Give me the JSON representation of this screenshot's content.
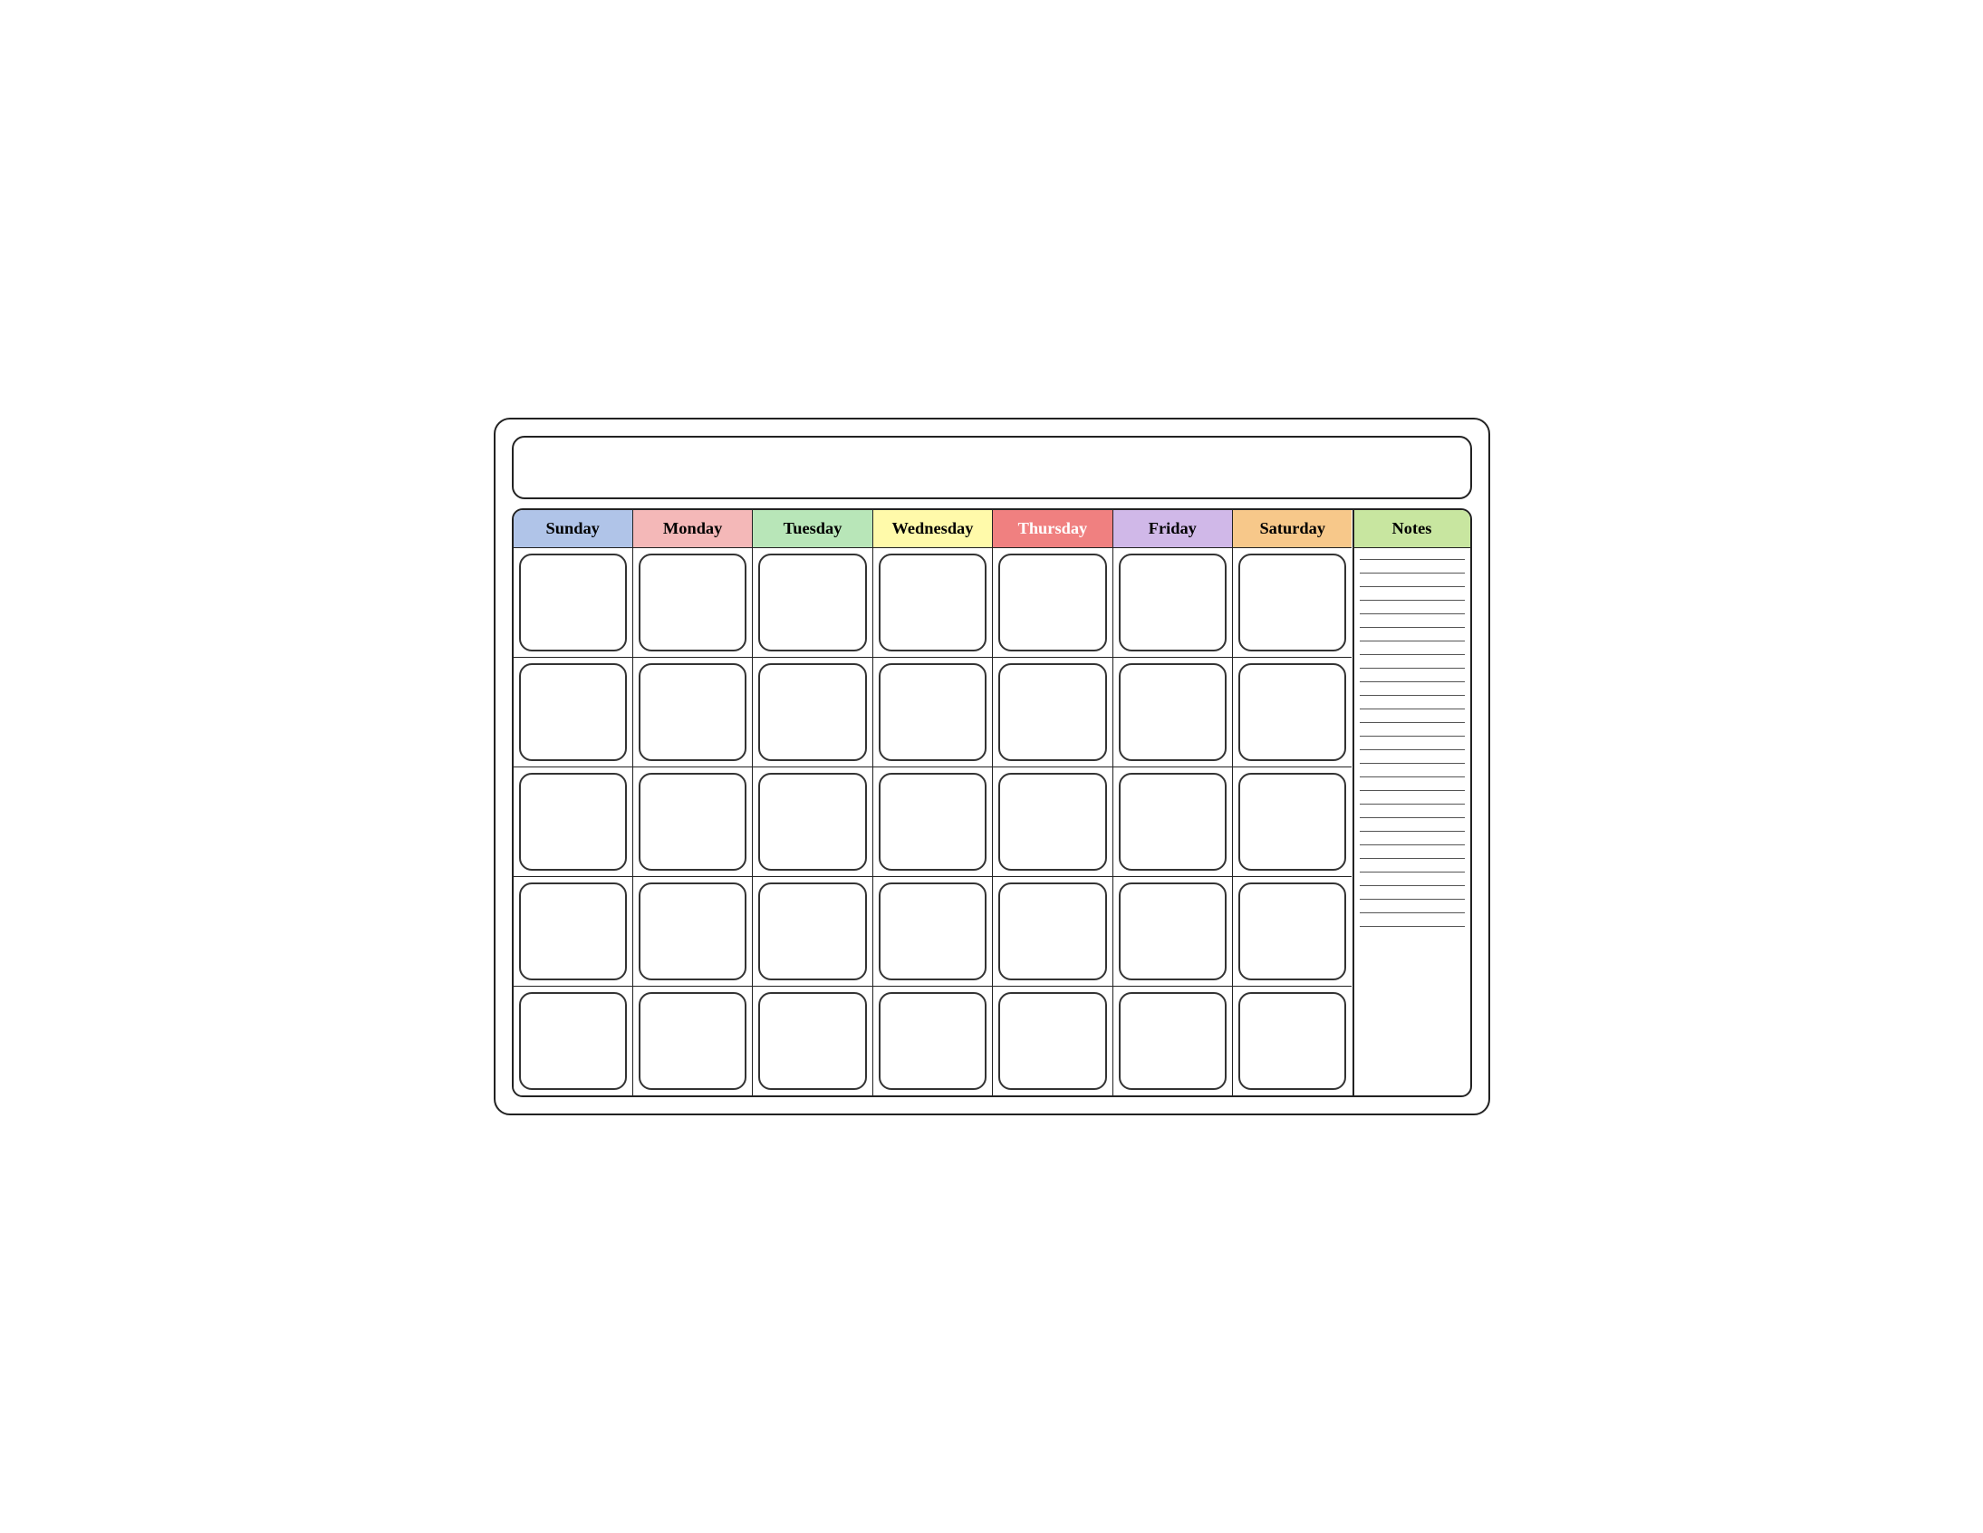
{
  "calendar": {
    "title": "",
    "days": {
      "sunday": "Sunday",
      "monday": "Monday",
      "tuesday": "Tuesday",
      "wednesday": "Wednesday",
      "thursday": "Thursday",
      "friday": "Friday",
      "saturday": "Saturday"
    },
    "notes_label": "Notes",
    "rows": 5,
    "notes_lines": 28
  }
}
